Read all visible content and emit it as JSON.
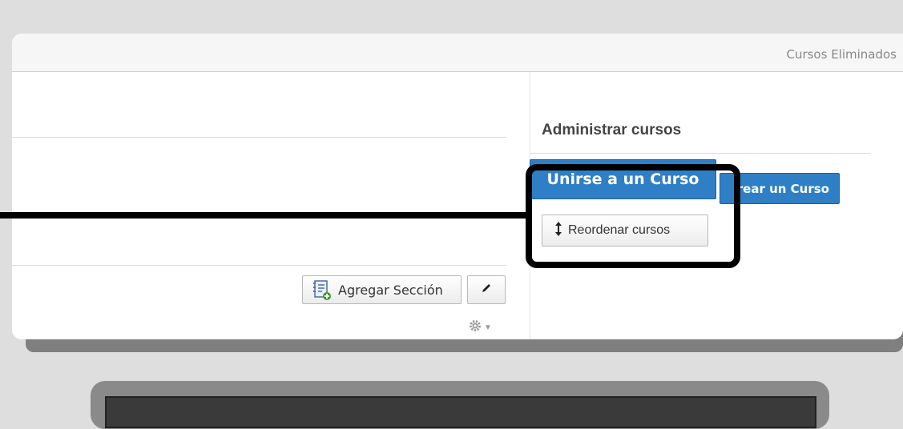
{
  "header": {
    "deleted_courses_link": "Cursos Eliminados"
  },
  "main": {
    "add_section_label": "Agregar Sección"
  },
  "sidebar": {
    "admin_title": "Administrar cursos",
    "join_course_label": "Unirse a un Curso",
    "create_course_label": "rear un Curso",
    "reorder_label": "Reordenar cursos"
  },
  "colors": {
    "primary_button": "#2f7fc6",
    "highlight_border": "#000000",
    "background": "#dedede"
  },
  "icons": {
    "add_section": "section-add-icon",
    "edit": "pencil-icon",
    "settings": "gear-icon",
    "reorder": "up-down-arrows-icon"
  }
}
